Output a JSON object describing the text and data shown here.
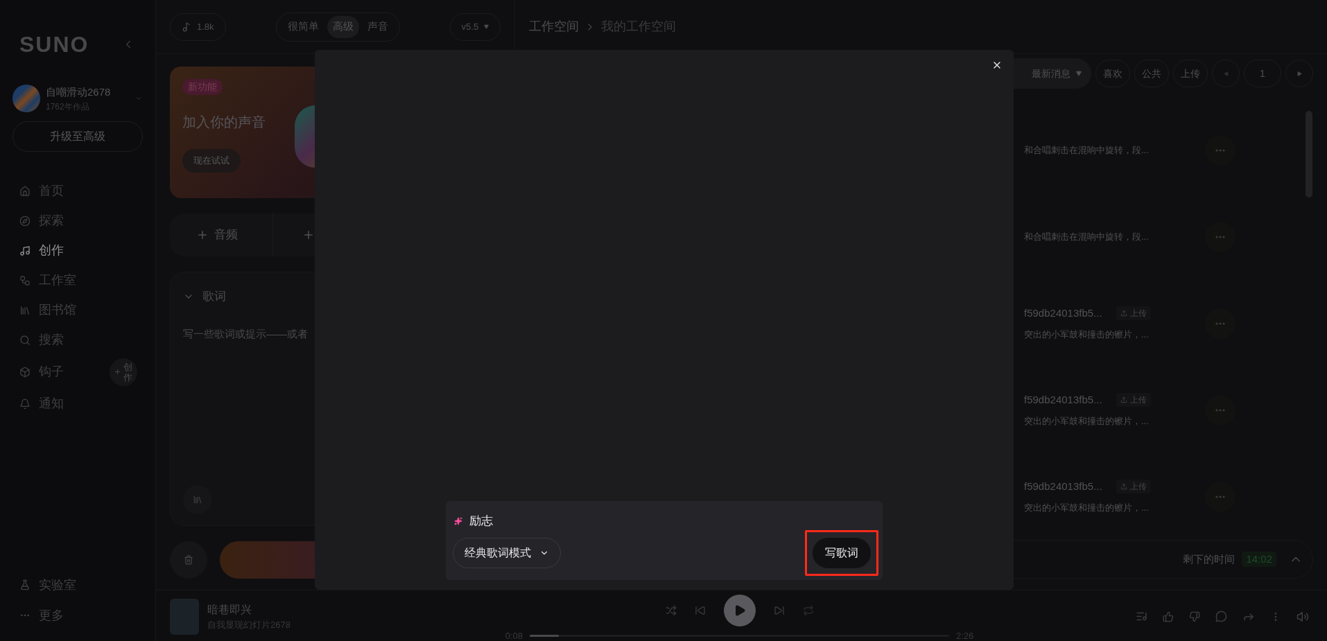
{
  "sidebar": {
    "logo": "SUNO",
    "user": {
      "name": "自嘲滑动2678",
      "subtitle": "1762年作品"
    },
    "upgrade_button": "升级至高级",
    "nav": [
      {
        "label": "首页",
        "selected": false
      },
      {
        "label": "探索",
        "selected": false
      },
      {
        "label": "创作",
        "selected": true
      },
      {
        "label": "工作室",
        "selected": false
      },
      {
        "label": "图书馆",
        "selected": false
      },
      {
        "label": "搜索",
        "selected": false
      },
      {
        "label": "钩子",
        "selected": false,
        "action": "创作"
      },
      {
        "label": "通知",
        "selected": false
      }
    ],
    "bottom_nav": [
      {
        "label": "实验室"
      },
      {
        "label": "更多"
      }
    ]
  },
  "topbar": {
    "credits": "1.8k",
    "modes": [
      {
        "label": "很简单",
        "selected": false
      },
      {
        "label": "高级",
        "selected": true
      },
      {
        "label": "声音",
        "selected": false
      }
    ],
    "version": "v5.5",
    "breadcrumb": [
      "工作空间",
      "我的工作空间"
    ]
  },
  "create_panel": {
    "promo": {
      "badge": "新功能",
      "title": "加入你的声音",
      "button": "现在试试"
    },
    "add_buttons": [
      "音频"
    ],
    "lyrics": {
      "title": "歌词",
      "expanded": true,
      "placeholder": "写一些歌词或提示——或者"
    }
  },
  "workspace": {
    "filters": [
      {
        "label": "最新消息",
        "kind": "dropdown"
      },
      {
        "label": "喜欢",
        "kind": "toggle"
      },
      {
        "label": "公共",
        "kind": "toggle"
      },
      {
        "label": "上传",
        "kind": "toggle"
      }
    ],
    "page": "1",
    "songs": [
      {
        "description": "和合唱刺击在混响中旋转，段..."
      },
      {
        "description": "和合唱刺击在混响中旋转，段..."
      },
      {
        "title": "f59db24013fb5...",
        "badge": "上传",
        "description": "突出的小军鼓和撞击的镲片，..."
      },
      {
        "title": "f59db24013fb5...",
        "badge": "上传",
        "description": "突出的小军鼓和撞击的镲片，..."
      },
      {
        "title": "f59db24013fb5...",
        "badge": "上传",
        "description": "突出的小军鼓和撞击的镲片，..."
      }
    ]
  },
  "remaining": {
    "label": "剩下的时间",
    "time": "14:02"
  },
  "player": {
    "title": "暗巷即兴",
    "artist": "自我显现幻灯片2678",
    "elapsed": "0:08",
    "duration": "2:26",
    "level": 0.07
  },
  "modal": {
    "prompt": "励志",
    "mode_select": "经典歌词模式",
    "submit_button": "写歌词",
    "highlighted": true
  }
}
